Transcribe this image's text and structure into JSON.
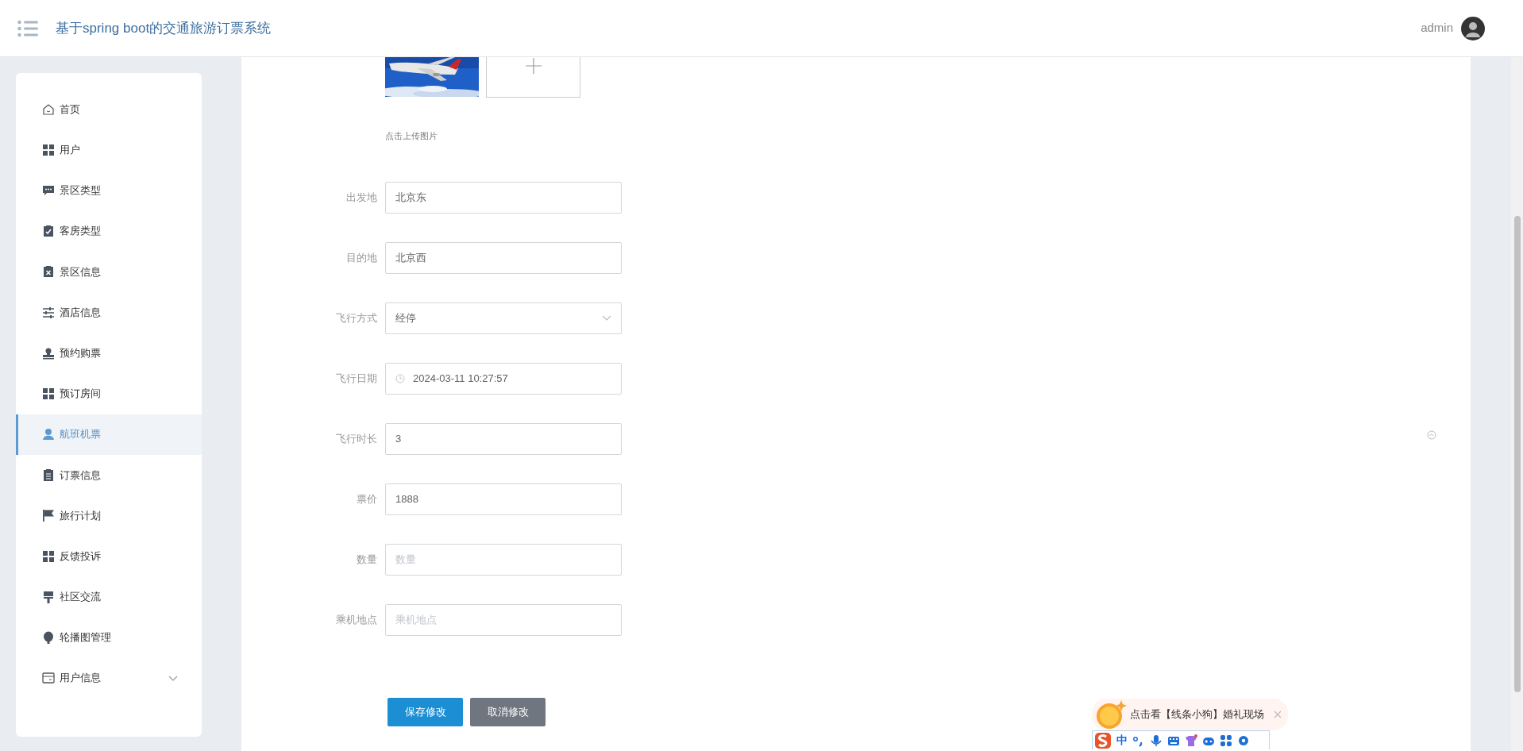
{
  "header": {
    "title": "基于spring boot的交通旅游订票系统",
    "user": "admin"
  },
  "sidebar": {
    "items": [
      {
        "label": "首页",
        "selected": false
      },
      {
        "label": "用户",
        "selected": false
      },
      {
        "label": "景区类型",
        "selected": false
      },
      {
        "label": "客房类型",
        "selected": false
      },
      {
        "label": "景区信息",
        "selected": false
      },
      {
        "label": "酒店信息",
        "selected": false
      },
      {
        "label": "预约购票",
        "selected": false
      },
      {
        "label": "预订房间",
        "selected": false
      },
      {
        "label": "航班机票",
        "selected": true
      },
      {
        "label": "订票信息",
        "selected": false
      },
      {
        "label": "旅行计划",
        "selected": false
      },
      {
        "label": "反馈投诉",
        "selected": false
      },
      {
        "label": "社区交流",
        "selected": false
      },
      {
        "label": "轮播图管理",
        "selected": false
      },
      {
        "label": "用户信息",
        "selected": false,
        "expanded": false
      }
    ]
  },
  "form": {
    "upload": {
      "hint": "点击上传图片"
    },
    "fields": [
      {
        "label": "出发地",
        "kind": "text",
        "value": "北京东"
      },
      {
        "label": "目的地",
        "kind": "text",
        "value": "北京西"
      },
      {
        "label": "飞行方式",
        "kind": "select",
        "value": "经停"
      },
      {
        "label": "飞行日期",
        "kind": "datetime",
        "value": "2024-03-11 10:27:57"
      },
      {
        "label": "飞行时长",
        "kind": "text",
        "value": "3"
      },
      {
        "label": "票价",
        "kind": "text",
        "value": "1888"
      },
      {
        "label": "数量",
        "kind": "text",
        "placeholder": "数量"
      },
      {
        "label": "乘机地点",
        "kind": "text",
        "placeholder": "乘机地点"
      }
    ],
    "buttons": [
      {
        "label": "保存修改",
        "kind": "primary"
      },
      {
        "label": "取消修改",
        "kind": "secondary"
      }
    ]
  },
  "ime": {
    "message": "点击看【线条小狗】婚礼现场",
    "mode": "中"
  }
}
